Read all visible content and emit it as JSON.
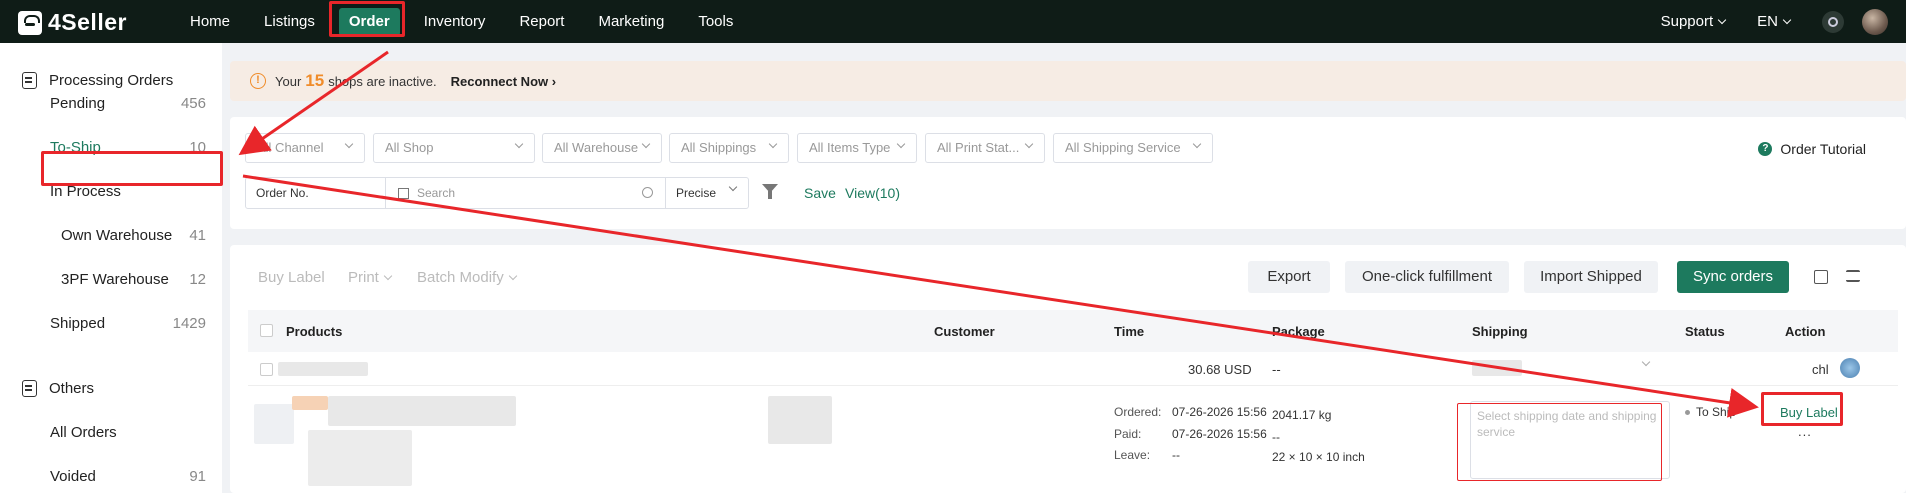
{
  "topbar": {
    "logo": "4Seller",
    "nav": [
      "Home",
      "Listings",
      "Order",
      "Inventory",
      "Report",
      "Marketing",
      "Tools"
    ],
    "active_nav": "Order",
    "support": "Support",
    "language": "EN"
  },
  "sidebar": {
    "group1": "Processing Orders",
    "items": [
      {
        "label": "Pending",
        "count": "456"
      },
      {
        "label": "To-Ship",
        "count": "10"
      },
      {
        "label": "In Process",
        "count": ""
      },
      {
        "label": "Own Warehouse",
        "count": "41"
      },
      {
        "label": "3PF Warehouse",
        "count": "12"
      },
      {
        "label": "Shipped",
        "count": "1429"
      }
    ],
    "group2": "Others",
    "others": [
      {
        "label": "All Orders",
        "count": ""
      },
      {
        "label": "Voided",
        "count": "91"
      }
    ]
  },
  "banner": {
    "prefix": "Your",
    "count": "15",
    "suffix": "shops are inactive.",
    "action": "Reconnect Now"
  },
  "filters": {
    "selects": [
      "All Channel",
      "All Shop",
      "All Warehouse",
      "All Shippings",
      "All Items Type",
      "All Print Stat...",
      "All Shipping Service"
    ],
    "tutorial": "Order Tutorial",
    "search_field": "Order No.",
    "search_placeholder": "Search",
    "match_mode": "Precise",
    "save": "Save",
    "view": "View(10)"
  },
  "toolbar": {
    "buy_label": "Buy Label",
    "print": "Print",
    "batch_modify": "Batch Modify",
    "export": "Export",
    "one_click": "One-click fulfillment",
    "import_shipped": "Import Shipped",
    "sync": "Sync orders"
  },
  "table": {
    "headers": [
      "Products",
      "Customer",
      "Time",
      "Package",
      "Shipping",
      "Status",
      "Action"
    ],
    "order": {
      "total": "30.68 USD",
      "package_header": "--",
      "owner": "chl",
      "ordered_label": "Ordered:",
      "ordered": "07-26-2026 15:56",
      "paid_label": "Paid:",
      "paid": "07-26-2026 15:56",
      "leave_label": "Leave:",
      "leave": "--",
      "weight": "2041.17 kg",
      "package_dash": "--",
      "dimensions": "22 × 10 × 10 inch",
      "shipping_placeholder": "Select shipping date and shipping service",
      "status": "To Ship",
      "action": "Buy Label",
      "more": "..."
    }
  },
  "colors": {
    "brand_green": "#1d7a5e",
    "annotation_red": "#e8262a",
    "warning_orange": "#f08c2a"
  }
}
